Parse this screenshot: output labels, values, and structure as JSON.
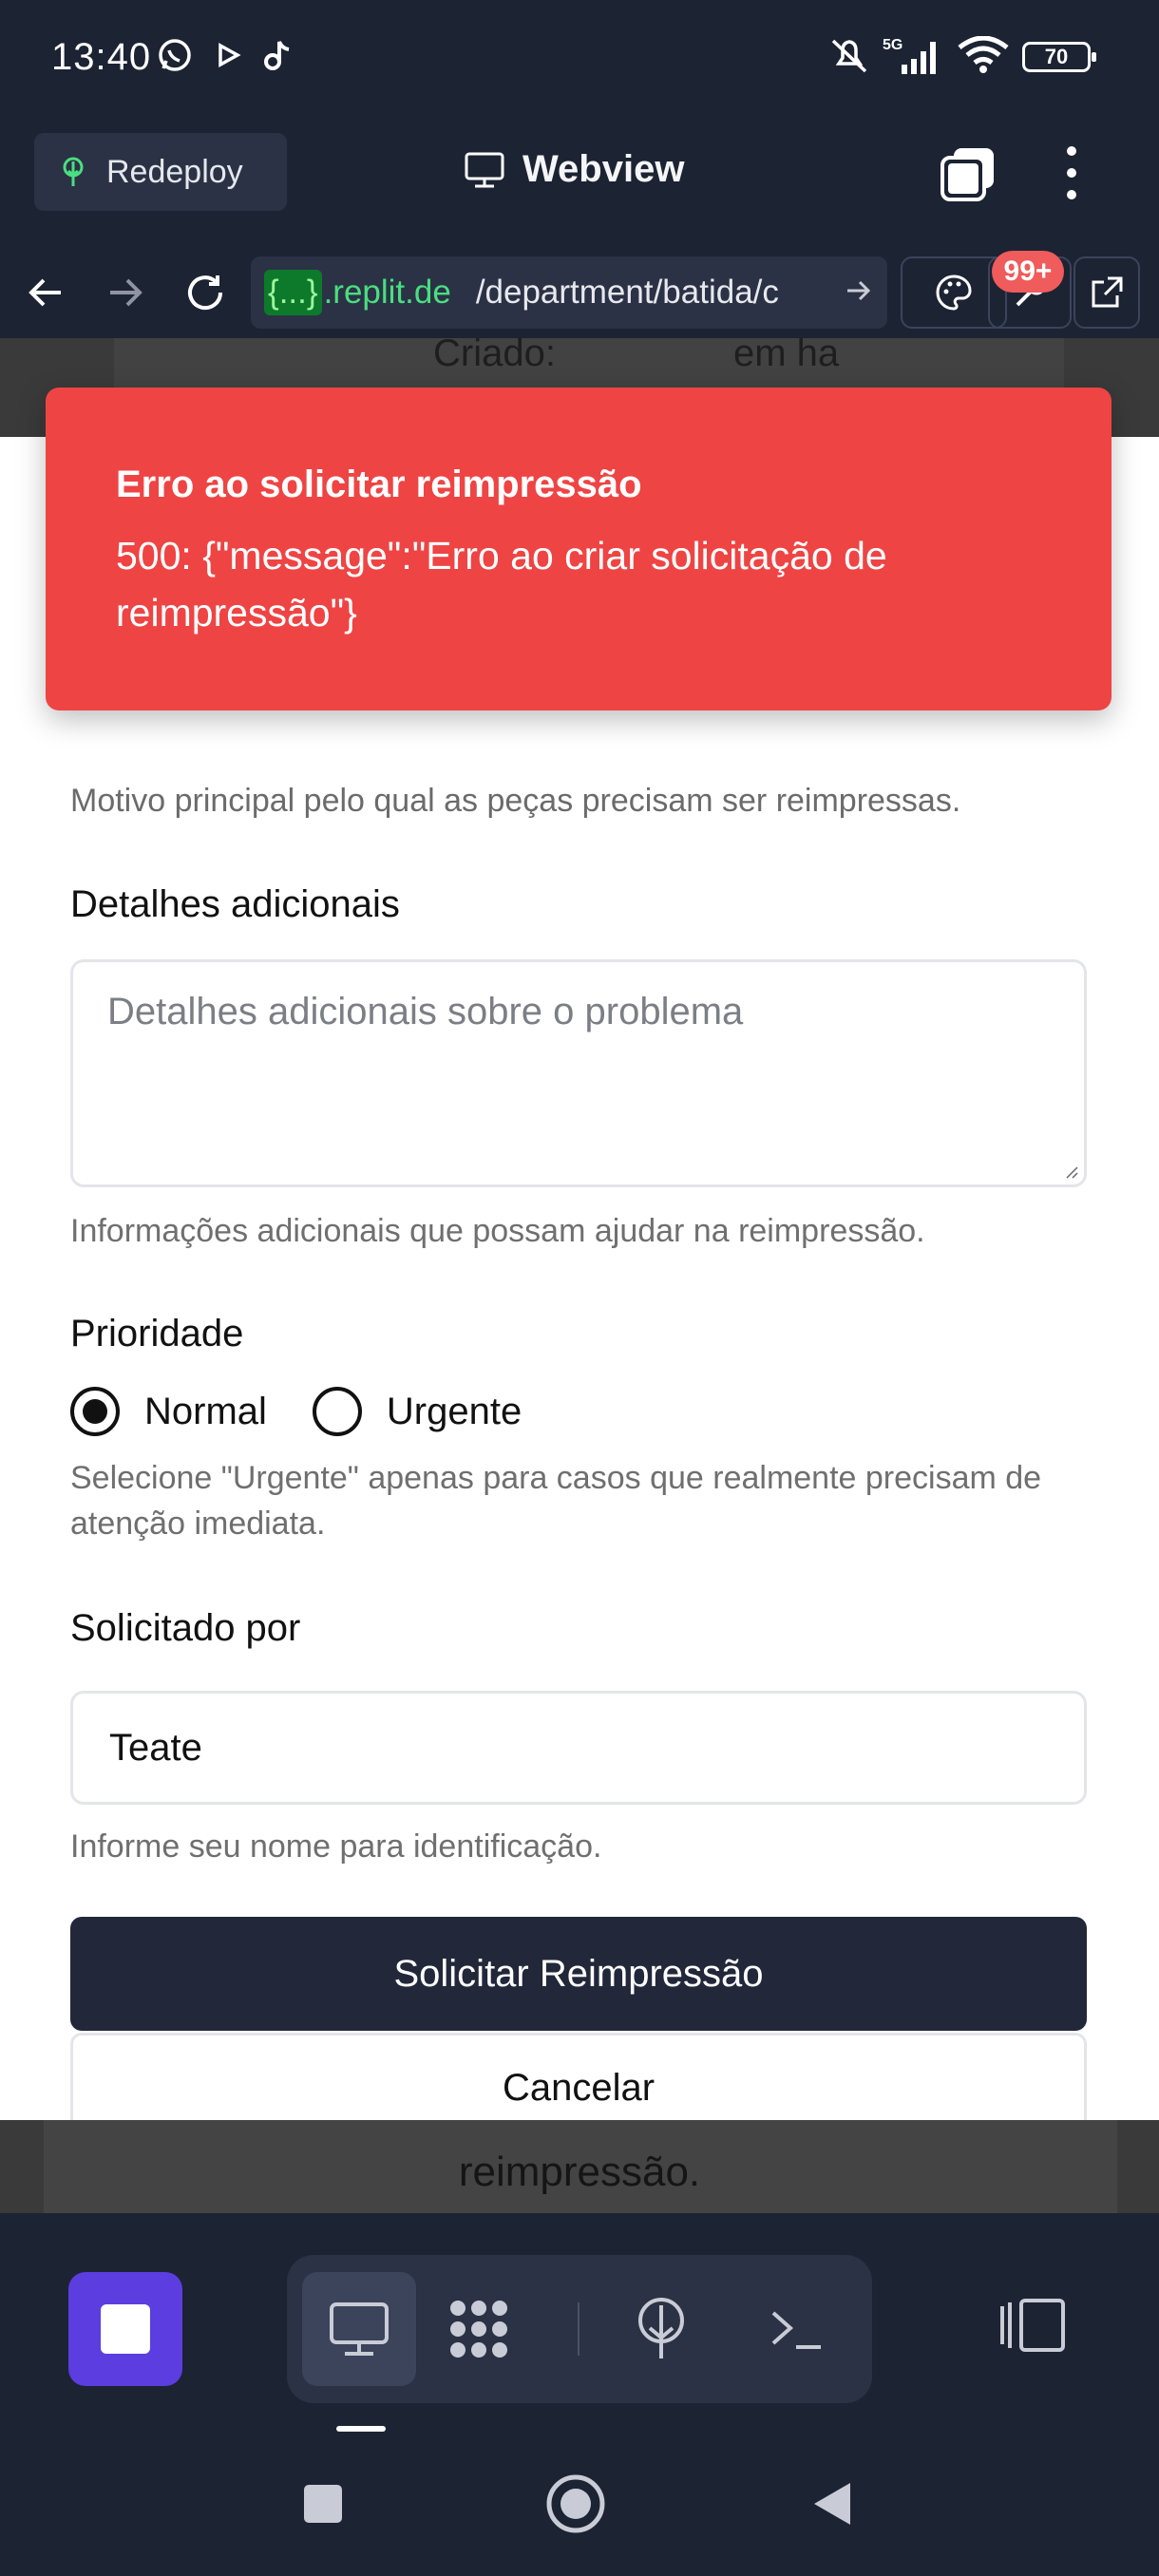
{
  "status_bar": {
    "time": "13:40",
    "network": "5G",
    "battery": "70"
  },
  "app_bar": {
    "redeploy_label": "Redeploy",
    "tab_title": "Webview"
  },
  "url_bar": {
    "host_pill": "{...}",
    "host": ".replit.de",
    "path": "/department/batida/c",
    "notification_badge": "99+"
  },
  "background_page": {
    "created_label": "Criado:",
    "created_value": "em ha",
    "bottom_text": "reimpressão."
  },
  "toast": {
    "title": "Erro ao solicitar reimpressão",
    "message": "500: {\"message\":\"Erro ao criar solicitação de reimpressão\"}"
  },
  "form": {
    "reason_help_partial": "Motivo principal pelo qual as peças precisam ser reimpressas.",
    "details": {
      "label": "Detalhes adicionais",
      "placeholder": "Detalhes adicionais sobre o problema",
      "help": "Informações adicionais que possam ajudar na reimpressão."
    },
    "priority": {
      "label": "Prioridade",
      "options": [
        "Normal",
        "Urgente"
      ],
      "selected": "Normal",
      "help": "Selecione \"Urgente\" apenas para casos que realmente precisam de atenção imediata."
    },
    "requested_by": {
      "label": "Solicitado por",
      "value": "Teate",
      "help": "Informe seu nome para identificação."
    },
    "submit_label": "Solicitar Reimpressão",
    "cancel_label": "Cancelar"
  },
  "colors": {
    "toast_bg": "#ef4444",
    "primary_button": "#222739",
    "chrome_bg": "#1c2333",
    "stop_button": "#5c3de0"
  },
  "icons": {
    "status": [
      "whatsapp-icon",
      "play-icon",
      "tiktok-icon",
      "mute-icon",
      "signal-icon",
      "wifi-icon",
      "battery-icon"
    ],
    "toolbar": [
      "stop-icon",
      "webview-icon",
      "workspace-icon",
      "deploy-icon",
      "shell-icon",
      "panel-icon"
    ]
  }
}
